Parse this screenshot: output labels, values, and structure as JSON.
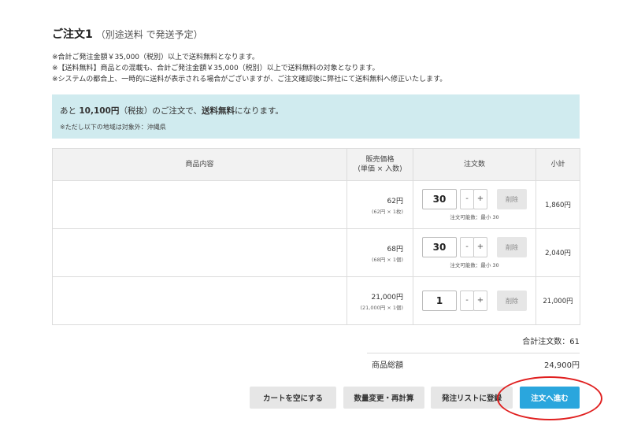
{
  "order": {
    "title": "ご注文1",
    "subtitle": "（別途送料 で発送予定）"
  },
  "notes": [
    "※合計ご発注金額￥35,000（税別）以上で送料無料となります。",
    "※【送料無料】商品との混載も、合計ご発注金額￥35,000（税別）以上で送料無料の対象となります。",
    "※システムの都合上、一時的に送料が表示される場合がございますが、ご注文確認後に弊社にて送料無料へ修正いたします。"
  ],
  "notice": {
    "prefix": "あと ",
    "amount": "10,100円",
    "middle": "（税抜）のご注文で、",
    "free_shipping": "送料無料",
    "suffix": "になります。",
    "exclusion": "※ただし以下の地域は対象外：沖縄県"
  },
  "table": {
    "headers": {
      "product": "商品内容",
      "price_line1": "販売価格",
      "price_line2": "(単価 × 入数)",
      "qty": "注文数",
      "subtotal": "小計"
    },
    "minus_label": "-",
    "plus_label": "+",
    "delete_label": "削除",
    "rows": [
      {
        "price": "62円",
        "unit": "(62円 × 1枚)",
        "qty": "30",
        "qty_note": "注文可能数：最小 30",
        "subtotal": "1,860円"
      },
      {
        "price": "68円",
        "unit": "(68円 × 1個)",
        "qty": "30",
        "qty_note": "注文可能数：最小 30",
        "subtotal": "2,040円"
      },
      {
        "price": "21,000円",
        "unit": "(21,000円 × 1個)",
        "qty": "1",
        "qty_note": "",
        "subtotal": "21,000円"
      }
    ]
  },
  "summary": {
    "total_count": "合計注文数：61",
    "total_label": "商品総額",
    "total_value": "24,900円"
  },
  "buttons": {
    "empty_cart": "カートを空にする",
    "recalculate": "数量変更・再計算",
    "add_to_list": "発注リストに登録",
    "proceed": "注文へ進む"
  },
  "colors": {
    "notice_bg": "#d0ebef",
    "primary": "#2aa6dd",
    "highlight": "#e02020"
  }
}
